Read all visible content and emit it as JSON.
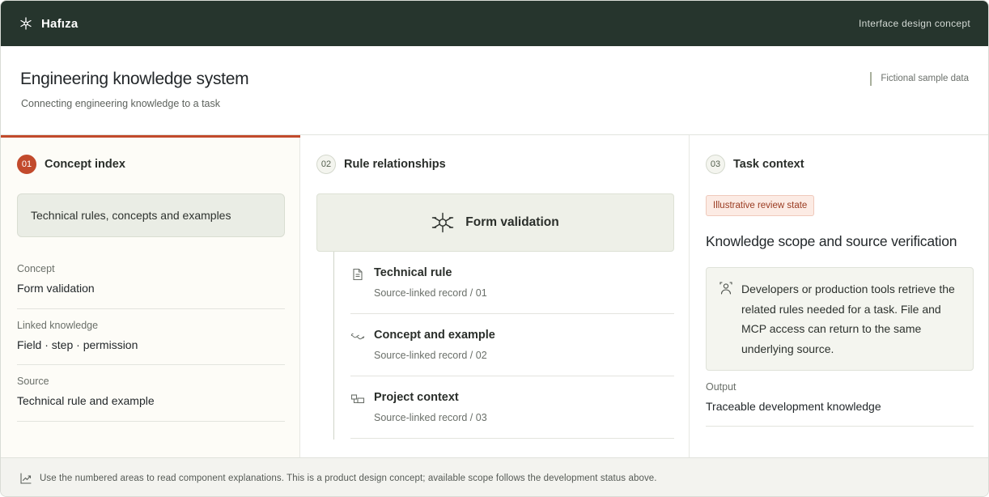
{
  "app": {
    "brand": "Hafıza",
    "brand_icon": "asterisk-logo-icon",
    "top_right": "Interface design concept"
  },
  "header": {
    "title": "Engineering knowledge system",
    "subtitle": "Connecting engineering knowledge to a task",
    "note": "Fictional sample data"
  },
  "columns": {
    "concept_index": {
      "number": "01",
      "title": "Concept index",
      "search_text": "Technical rules, concepts and examples",
      "fields": [
        {
          "label": "Concept",
          "value": "Form validation"
        },
        {
          "label": "Linked knowledge",
          "value": "Field · step · permission"
        },
        {
          "label": "Source",
          "value": "Technical rule and example"
        }
      ]
    },
    "rule_relationships": {
      "number": "02",
      "title": "Rule relationships",
      "hub_label": "Form validation",
      "hub_icon": "node-network-icon",
      "items": [
        {
          "title": "Technical rule",
          "subtitle": "Source-linked record / 01",
          "icon": "document-icon"
        },
        {
          "title": "Concept and example",
          "subtitle": "Source-linked record / 02",
          "icon": "link-wave-icon"
        },
        {
          "title": "Project context",
          "subtitle": "Source-linked record / 03",
          "icon": "structure-icon"
        }
      ]
    },
    "task_context": {
      "number": "03",
      "title": "Task context",
      "badge": "Illustrative review state",
      "heading": "Knowledge scope and source verification",
      "description": "Developers or production tools retrieve the related rules needed for a task. File and MCP access can return to the same underlying source.",
      "description_icon": "user-scope-icon",
      "output_label": "Output",
      "output_value": "Traceable development knowledge"
    }
  },
  "footer": {
    "icon": "chart-trend-icon",
    "text": "Use the numbered areas to read component explanations. This is a product design concept; available scope follows the development status above."
  },
  "colors": {
    "topbar": "#26352d",
    "accent": "#c24a2c",
    "hub_bg": "#eef0e8",
    "badge_bg": "#fcebe4"
  }
}
